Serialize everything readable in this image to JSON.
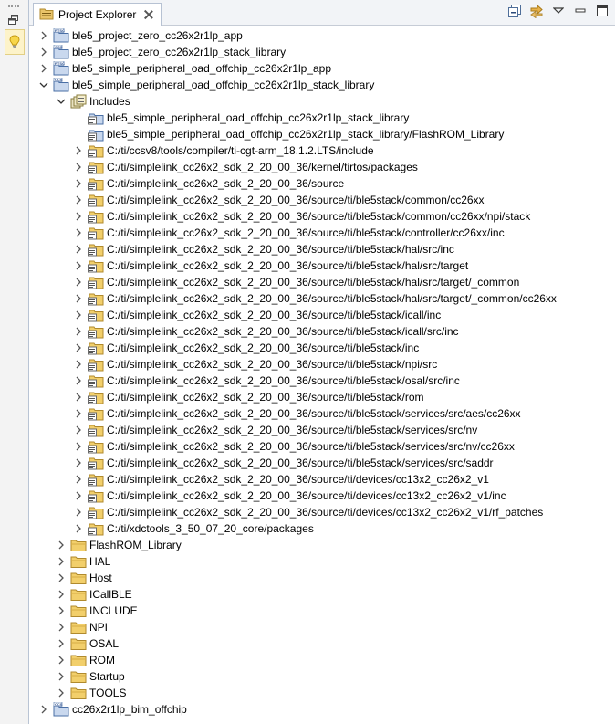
{
  "panel": {
    "title": "Project Explorer",
    "toolbar": [
      {
        "name": "collapse-all-icon"
      },
      {
        "name": "link-with-editor-icon"
      },
      {
        "name": "view-menu-icon"
      },
      {
        "name": "minimize-icon"
      },
      {
        "name": "maximize-icon"
      }
    ]
  },
  "side": {
    "items": [
      {
        "name": "restore-icon"
      },
      {
        "name": "lightbulb-icon"
      }
    ]
  },
  "tree": [
    {
      "label": "ble5_project_zero_cc26x2r1lp_app",
      "level": 0,
      "toggle": "collapsed",
      "icon": "project-rtsc-icon"
    },
    {
      "label": "ble5_project_zero_cc26x2r1lp_stack_library",
      "level": 0,
      "toggle": "collapsed",
      "icon": "project-ccs-icon"
    },
    {
      "label": "ble5_simple_peripheral_oad_offchip_cc26x2r1lp_app",
      "level": 0,
      "toggle": "collapsed",
      "icon": "project-rtsc-icon"
    },
    {
      "label": "ble5_simple_peripheral_oad_offchip_cc26x2r1lp_stack_library",
      "level": 0,
      "toggle": "expanded",
      "icon": "project-ccs-icon"
    },
    {
      "label": "Includes",
      "level": 1,
      "toggle": "expanded",
      "icon": "includes-icon"
    },
    {
      "label": "ble5_simple_peripheral_oad_offchip_cc26x2r1lp_stack_library",
      "level": 2,
      "toggle": "none",
      "icon": "include-project-icon"
    },
    {
      "label": "ble5_simple_peripheral_oad_offchip_cc26x2r1lp_stack_library/FlashROM_Library",
      "level": 2,
      "toggle": "none",
      "icon": "include-project-icon"
    },
    {
      "label": "C:/ti/ccsv8/tools/compiler/ti-cgt-arm_18.1.2.LTS/include",
      "level": 2,
      "toggle": "collapsed",
      "icon": "include-folder-icon"
    },
    {
      "label": "C:/ti/simplelink_cc26x2_sdk_2_20_00_36/kernel/tirtos/packages",
      "level": 2,
      "toggle": "collapsed",
      "icon": "include-folder-icon"
    },
    {
      "label": "C:/ti/simplelink_cc26x2_sdk_2_20_00_36/source",
      "level": 2,
      "toggle": "collapsed",
      "icon": "include-folder-icon"
    },
    {
      "label": "C:/ti/simplelink_cc26x2_sdk_2_20_00_36/source/ti/ble5stack/common/cc26xx",
      "level": 2,
      "toggle": "collapsed",
      "icon": "include-folder-icon"
    },
    {
      "label": "C:/ti/simplelink_cc26x2_sdk_2_20_00_36/source/ti/ble5stack/common/cc26xx/npi/stack",
      "level": 2,
      "toggle": "collapsed",
      "icon": "include-folder-icon"
    },
    {
      "label": "C:/ti/simplelink_cc26x2_sdk_2_20_00_36/source/ti/ble5stack/controller/cc26xx/inc",
      "level": 2,
      "toggle": "collapsed",
      "icon": "include-folder-icon"
    },
    {
      "label": "C:/ti/simplelink_cc26x2_sdk_2_20_00_36/source/ti/ble5stack/hal/src/inc",
      "level": 2,
      "toggle": "collapsed",
      "icon": "include-folder-icon"
    },
    {
      "label": "C:/ti/simplelink_cc26x2_sdk_2_20_00_36/source/ti/ble5stack/hal/src/target",
      "level": 2,
      "toggle": "collapsed",
      "icon": "include-folder-icon"
    },
    {
      "label": "C:/ti/simplelink_cc26x2_sdk_2_20_00_36/source/ti/ble5stack/hal/src/target/_common",
      "level": 2,
      "toggle": "collapsed",
      "icon": "include-folder-icon"
    },
    {
      "label": "C:/ti/simplelink_cc26x2_sdk_2_20_00_36/source/ti/ble5stack/hal/src/target/_common/cc26xx",
      "level": 2,
      "toggle": "collapsed",
      "icon": "include-folder-icon"
    },
    {
      "label": "C:/ti/simplelink_cc26x2_sdk_2_20_00_36/source/ti/ble5stack/icall/inc",
      "level": 2,
      "toggle": "collapsed",
      "icon": "include-folder-icon"
    },
    {
      "label": "C:/ti/simplelink_cc26x2_sdk_2_20_00_36/source/ti/ble5stack/icall/src/inc",
      "level": 2,
      "toggle": "collapsed",
      "icon": "include-folder-icon"
    },
    {
      "label": "C:/ti/simplelink_cc26x2_sdk_2_20_00_36/source/ti/ble5stack/inc",
      "level": 2,
      "toggle": "collapsed",
      "icon": "include-folder-icon"
    },
    {
      "label": "C:/ti/simplelink_cc26x2_sdk_2_20_00_36/source/ti/ble5stack/npi/src",
      "level": 2,
      "toggle": "collapsed",
      "icon": "include-folder-icon"
    },
    {
      "label": "C:/ti/simplelink_cc26x2_sdk_2_20_00_36/source/ti/ble5stack/osal/src/inc",
      "level": 2,
      "toggle": "collapsed",
      "icon": "include-folder-icon"
    },
    {
      "label": "C:/ti/simplelink_cc26x2_sdk_2_20_00_36/source/ti/ble5stack/rom",
      "level": 2,
      "toggle": "collapsed",
      "icon": "include-folder-icon"
    },
    {
      "label": "C:/ti/simplelink_cc26x2_sdk_2_20_00_36/source/ti/ble5stack/services/src/aes/cc26xx",
      "level": 2,
      "toggle": "collapsed",
      "icon": "include-folder-icon"
    },
    {
      "label": "C:/ti/simplelink_cc26x2_sdk_2_20_00_36/source/ti/ble5stack/services/src/nv",
      "level": 2,
      "toggle": "collapsed",
      "icon": "include-folder-icon"
    },
    {
      "label": "C:/ti/simplelink_cc26x2_sdk_2_20_00_36/source/ti/ble5stack/services/src/nv/cc26xx",
      "level": 2,
      "toggle": "collapsed",
      "icon": "include-folder-icon"
    },
    {
      "label": "C:/ti/simplelink_cc26x2_sdk_2_20_00_36/source/ti/ble5stack/services/src/saddr",
      "level": 2,
      "toggle": "collapsed",
      "icon": "include-folder-icon"
    },
    {
      "label": "C:/ti/simplelink_cc26x2_sdk_2_20_00_36/source/ti/devices/cc13x2_cc26x2_v1",
      "level": 2,
      "toggle": "collapsed",
      "icon": "include-folder-icon"
    },
    {
      "label": "C:/ti/simplelink_cc26x2_sdk_2_20_00_36/source/ti/devices/cc13x2_cc26x2_v1/inc",
      "level": 2,
      "toggle": "collapsed",
      "icon": "include-folder-icon"
    },
    {
      "label": "C:/ti/simplelink_cc26x2_sdk_2_20_00_36/source/ti/devices/cc13x2_cc26x2_v1/rf_patches",
      "level": 2,
      "toggle": "collapsed",
      "icon": "include-folder-icon"
    },
    {
      "label": "C:/ti/xdctools_3_50_07_20_core/packages",
      "level": 2,
      "toggle": "collapsed",
      "icon": "include-folder-icon"
    },
    {
      "label": "FlashROM_Library",
      "level": 1,
      "toggle": "collapsed",
      "icon": "folder-icon"
    },
    {
      "label": "HAL",
      "level": 1,
      "toggle": "collapsed",
      "icon": "folder-icon"
    },
    {
      "label": "Host",
      "level": 1,
      "toggle": "collapsed",
      "icon": "folder-icon"
    },
    {
      "label": "ICallBLE",
      "level": 1,
      "toggle": "collapsed",
      "icon": "folder-icon"
    },
    {
      "label": "INCLUDE",
      "level": 1,
      "toggle": "collapsed",
      "icon": "folder-icon"
    },
    {
      "label": "NPI",
      "level": 1,
      "toggle": "collapsed",
      "icon": "folder-icon"
    },
    {
      "label": "OSAL",
      "level": 1,
      "toggle": "collapsed",
      "icon": "folder-icon"
    },
    {
      "label": "ROM",
      "level": 1,
      "toggle": "collapsed",
      "icon": "folder-icon"
    },
    {
      "label": "Startup",
      "level": 1,
      "toggle": "collapsed",
      "icon": "folder-icon"
    },
    {
      "label": "TOOLS",
      "level": 1,
      "toggle": "collapsed",
      "icon": "folder-icon"
    },
    {
      "label": "cc26x2r1lp_bim_offchip",
      "level": 0,
      "toggle": "collapsed",
      "icon": "project-ccs-icon"
    }
  ]
}
